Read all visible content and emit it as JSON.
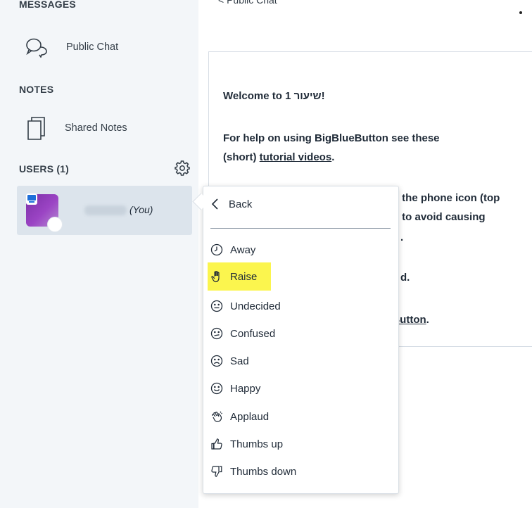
{
  "sidebar": {
    "messages_title": "MESSAGES",
    "public_chat_label": "Public Chat",
    "notes_title": "NOTES",
    "shared_notes_label": "Shared Notes",
    "users_title": "USERS (1)",
    "current_user_suffix": "(You)"
  },
  "chat": {
    "header": "< Public Chat",
    "messages": [
      {
        "text": "Welcome to 1 שיעור!"
      },
      {
        "text": "For help on using BigBlueButton see these"
      },
      {
        "pre": "(short) ",
        "link": "tutorial videos",
        "post": "."
      },
      {
        "text": "t the phone icon (top"
      },
      {
        "text": "t to avoid causing"
      },
      {
        "text": "."
      },
      {
        "text": "d."
      },
      {
        "link": "eButton",
        "post": "."
      }
    ]
  },
  "status_menu": {
    "back_label": "Back",
    "items": [
      {
        "label": "Away",
        "icon": "clock-icon"
      },
      {
        "label": "Raise",
        "icon": "raised-hand-icon"
      },
      {
        "label": "Undecided",
        "icon": "neutral-face-icon"
      },
      {
        "label": "Confused",
        "icon": "confused-face-icon"
      },
      {
        "label": "Sad",
        "icon": "sad-face-icon"
      },
      {
        "label": "Happy",
        "icon": "happy-face-icon"
      },
      {
        "label": "Applaud",
        "icon": "applaud-icon"
      },
      {
        "label": "Thumbs up",
        "icon": "thumbs-up-icon"
      },
      {
        "label": "Thumbs down",
        "icon": "thumbs-down-icon"
      }
    ]
  },
  "colors": {
    "sidebar_bg": "#f3f6f9",
    "selected_user_bg": "#dce4ec",
    "avatar": "#7b2fa6",
    "highlight": "#fbf54e"
  }
}
